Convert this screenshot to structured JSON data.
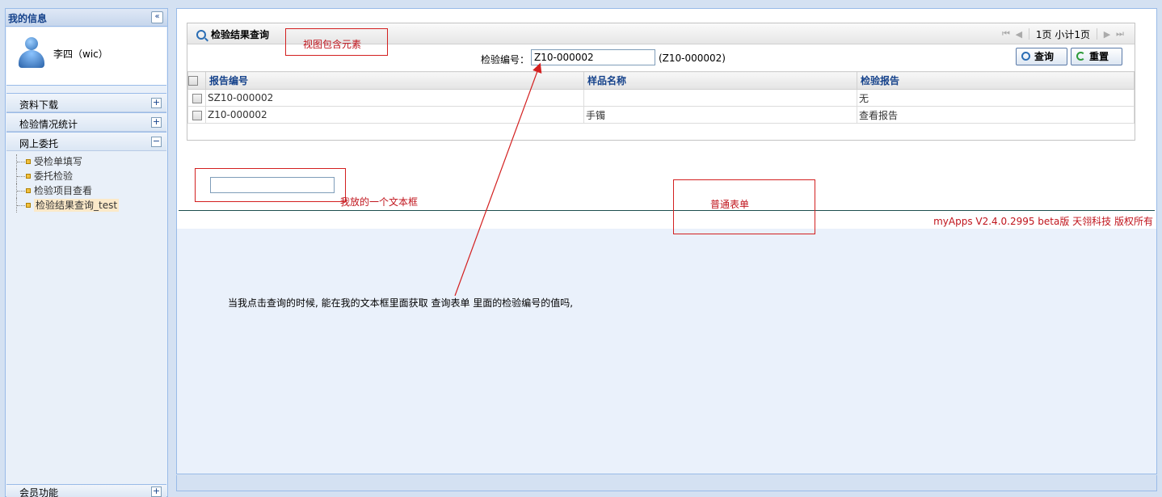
{
  "sidebar": {
    "my_info_title": "我的信息",
    "collapse_symbol": "«",
    "user_name": "李四（wic）",
    "sections": [
      {
        "label": "资料下载",
        "expand": "+"
      },
      {
        "label": "检验情况统计",
        "expand": "+"
      },
      {
        "label": "网上委托",
        "expand": "−"
      }
    ],
    "tree_items": [
      {
        "label": "受检单填写"
      },
      {
        "label": "委托检验"
      },
      {
        "label": "检验项目查看"
      },
      {
        "label": "检验结果查询_test",
        "selected": true
      }
    ],
    "bottom_section": {
      "label": "会员功能",
      "expand": "+"
    }
  },
  "view": {
    "title": "检验结果查询",
    "pager": {
      "first": "⏮",
      "prev": "◀",
      "info": "1页 小计1页",
      "next": "▶",
      "last": "⏭"
    },
    "filter": {
      "label": "检验编号：",
      "value": "Z10-000002",
      "hint": "(Z10-000002)"
    },
    "buttons": {
      "query": "查询",
      "reset": "重置"
    },
    "table": {
      "headers": [
        "报告编号",
        "样品名称",
        "检验报告"
      ],
      "rows": [
        [
          "SZ10-000002",
          "",
          "无"
        ],
        [
          "Z10-000002",
          "手镯",
          "查看报告"
        ]
      ]
    }
  },
  "annotations": {
    "view_contains": "视图包含元素",
    "my_textbox": "我放的一个文本框",
    "normal_form": "普通表单",
    "question": "当我点击查询的时候, 能在我的文本框里面获取    查询表单  里面的检验编号的值吗,"
  },
  "footer": {
    "copyright": "myApps V2.4.0.2995 beta版  天翎科技  版权所有"
  },
  "colors": {
    "accent": "#15428b",
    "annotation": "#d32020",
    "panel_border": "#99bbe8"
  }
}
